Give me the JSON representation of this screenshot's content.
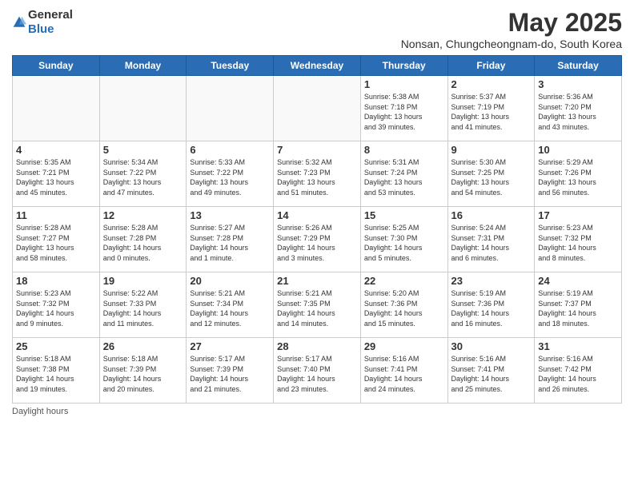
{
  "header": {
    "logo_general": "General",
    "logo_blue": "Blue",
    "month_title": "May 2025",
    "subtitle": "Nonsan, Chungcheongnam-do, South Korea"
  },
  "days_of_week": [
    "Sunday",
    "Monday",
    "Tuesday",
    "Wednesday",
    "Thursday",
    "Friday",
    "Saturday"
  ],
  "weeks": [
    [
      {
        "day": "",
        "info": ""
      },
      {
        "day": "",
        "info": ""
      },
      {
        "day": "",
        "info": ""
      },
      {
        "day": "",
        "info": ""
      },
      {
        "day": "1",
        "info": "Sunrise: 5:38 AM\nSunset: 7:18 PM\nDaylight: 13 hours\nand 39 minutes."
      },
      {
        "day": "2",
        "info": "Sunrise: 5:37 AM\nSunset: 7:19 PM\nDaylight: 13 hours\nand 41 minutes."
      },
      {
        "day": "3",
        "info": "Sunrise: 5:36 AM\nSunset: 7:20 PM\nDaylight: 13 hours\nand 43 minutes."
      }
    ],
    [
      {
        "day": "4",
        "info": "Sunrise: 5:35 AM\nSunset: 7:21 PM\nDaylight: 13 hours\nand 45 minutes."
      },
      {
        "day": "5",
        "info": "Sunrise: 5:34 AM\nSunset: 7:22 PM\nDaylight: 13 hours\nand 47 minutes."
      },
      {
        "day": "6",
        "info": "Sunrise: 5:33 AM\nSunset: 7:22 PM\nDaylight: 13 hours\nand 49 minutes."
      },
      {
        "day": "7",
        "info": "Sunrise: 5:32 AM\nSunset: 7:23 PM\nDaylight: 13 hours\nand 51 minutes."
      },
      {
        "day": "8",
        "info": "Sunrise: 5:31 AM\nSunset: 7:24 PM\nDaylight: 13 hours\nand 53 minutes."
      },
      {
        "day": "9",
        "info": "Sunrise: 5:30 AM\nSunset: 7:25 PM\nDaylight: 13 hours\nand 54 minutes."
      },
      {
        "day": "10",
        "info": "Sunrise: 5:29 AM\nSunset: 7:26 PM\nDaylight: 13 hours\nand 56 minutes."
      }
    ],
    [
      {
        "day": "11",
        "info": "Sunrise: 5:28 AM\nSunset: 7:27 PM\nDaylight: 13 hours\nand 58 minutes."
      },
      {
        "day": "12",
        "info": "Sunrise: 5:28 AM\nSunset: 7:28 PM\nDaylight: 14 hours\nand 0 minutes."
      },
      {
        "day": "13",
        "info": "Sunrise: 5:27 AM\nSunset: 7:28 PM\nDaylight: 14 hours\nand 1 minute."
      },
      {
        "day": "14",
        "info": "Sunrise: 5:26 AM\nSunset: 7:29 PM\nDaylight: 14 hours\nand 3 minutes."
      },
      {
        "day": "15",
        "info": "Sunrise: 5:25 AM\nSunset: 7:30 PM\nDaylight: 14 hours\nand 5 minutes."
      },
      {
        "day": "16",
        "info": "Sunrise: 5:24 AM\nSunset: 7:31 PM\nDaylight: 14 hours\nand 6 minutes."
      },
      {
        "day": "17",
        "info": "Sunrise: 5:23 AM\nSunset: 7:32 PM\nDaylight: 14 hours\nand 8 minutes."
      }
    ],
    [
      {
        "day": "18",
        "info": "Sunrise: 5:23 AM\nSunset: 7:32 PM\nDaylight: 14 hours\nand 9 minutes."
      },
      {
        "day": "19",
        "info": "Sunrise: 5:22 AM\nSunset: 7:33 PM\nDaylight: 14 hours\nand 11 minutes."
      },
      {
        "day": "20",
        "info": "Sunrise: 5:21 AM\nSunset: 7:34 PM\nDaylight: 14 hours\nand 12 minutes."
      },
      {
        "day": "21",
        "info": "Sunrise: 5:21 AM\nSunset: 7:35 PM\nDaylight: 14 hours\nand 14 minutes."
      },
      {
        "day": "22",
        "info": "Sunrise: 5:20 AM\nSunset: 7:36 PM\nDaylight: 14 hours\nand 15 minutes."
      },
      {
        "day": "23",
        "info": "Sunrise: 5:19 AM\nSunset: 7:36 PM\nDaylight: 14 hours\nand 16 minutes."
      },
      {
        "day": "24",
        "info": "Sunrise: 5:19 AM\nSunset: 7:37 PM\nDaylight: 14 hours\nand 18 minutes."
      }
    ],
    [
      {
        "day": "25",
        "info": "Sunrise: 5:18 AM\nSunset: 7:38 PM\nDaylight: 14 hours\nand 19 minutes."
      },
      {
        "day": "26",
        "info": "Sunrise: 5:18 AM\nSunset: 7:39 PM\nDaylight: 14 hours\nand 20 minutes."
      },
      {
        "day": "27",
        "info": "Sunrise: 5:17 AM\nSunset: 7:39 PM\nDaylight: 14 hours\nand 21 minutes."
      },
      {
        "day": "28",
        "info": "Sunrise: 5:17 AM\nSunset: 7:40 PM\nDaylight: 14 hours\nand 23 minutes."
      },
      {
        "day": "29",
        "info": "Sunrise: 5:16 AM\nSunset: 7:41 PM\nDaylight: 14 hours\nand 24 minutes."
      },
      {
        "day": "30",
        "info": "Sunrise: 5:16 AM\nSunset: 7:41 PM\nDaylight: 14 hours\nand 25 minutes."
      },
      {
        "day": "31",
        "info": "Sunrise: 5:16 AM\nSunset: 7:42 PM\nDaylight: 14 hours\nand 26 minutes."
      }
    ]
  ],
  "footer": {
    "note": "Daylight hours"
  }
}
